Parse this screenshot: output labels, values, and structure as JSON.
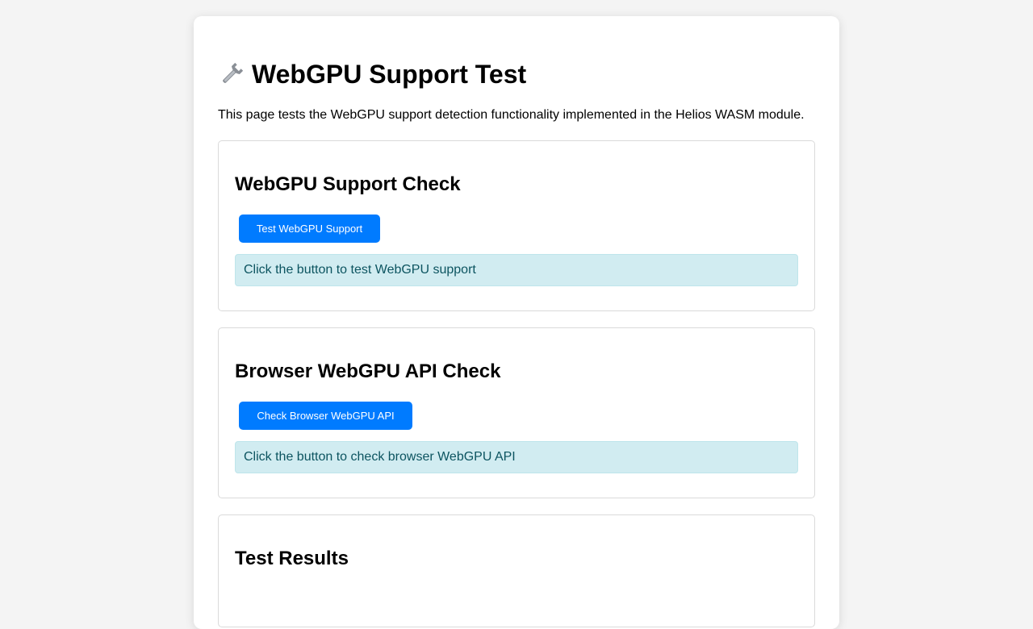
{
  "header": {
    "icon": "wrench-icon",
    "title": "WebGPU Support Test",
    "description": "This page tests the WebGPU support detection functionality implemented in the Helios WASM module."
  },
  "sections": [
    {
      "title": "WebGPU Support Check",
      "button_label": "Test WebGPU Support",
      "status": "Click the button to test WebGPU support"
    },
    {
      "title": "Browser WebGPU API Check",
      "button_label": "Check Browser WebGPU API",
      "status": "Click the button to check browser WebGPU API"
    },
    {
      "title": "Test Results"
    }
  ],
  "colors": {
    "accent": "#007bff",
    "info_bg": "#d1ecf1",
    "info_text": "#0c5460"
  }
}
